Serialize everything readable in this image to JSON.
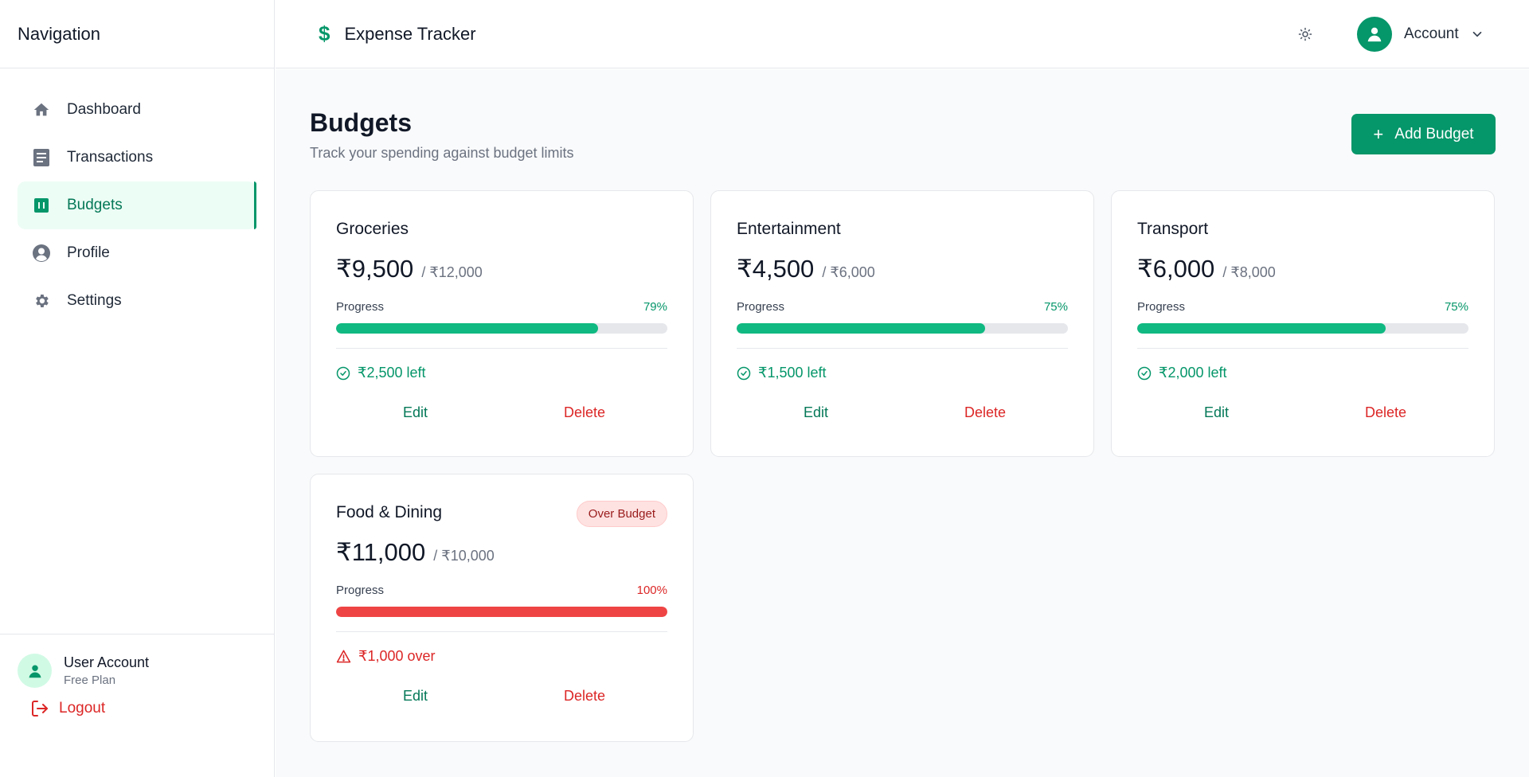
{
  "sidebar": {
    "title": "Navigation",
    "items": [
      {
        "label": "Dashboard",
        "icon": "home-icon"
      },
      {
        "label": "Transactions",
        "icon": "document-icon"
      },
      {
        "label": "Budgets",
        "icon": "chart-icon",
        "active": true
      },
      {
        "label": "Profile",
        "icon": "user-circle-icon"
      },
      {
        "label": "Settings",
        "icon": "gear-icon"
      }
    ],
    "user": {
      "name": "User Account",
      "plan": "Free Plan"
    },
    "logout_label": "Logout"
  },
  "header": {
    "app_title": "Expense Tracker",
    "account_label": "Account"
  },
  "page": {
    "title": "Budgets",
    "subtitle": "Track your spending against budget limits",
    "add_button_label": "Add Budget"
  },
  "budgets": [
    {
      "name": "Groceries",
      "spent": "₹9,500",
      "limit": "/ ₹12,000",
      "progress_label": "Progress",
      "percent_text": "79%",
      "progress": 0.79,
      "status": "₹2,500 left",
      "over": false,
      "edit_label": "Edit",
      "delete_label": "Delete"
    },
    {
      "name": "Entertainment",
      "spent": "₹4,500",
      "limit": "/ ₹6,000",
      "progress_label": "Progress",
      "percent_text": "75%",
      "progress": 0.75,
      "status": "₹1,500 left",
      "over": false,
      "edit_label": "Edit",
      "delete_label": "Delete"
    },
    {
      "name": "Transport",
      "spent": "₹6,000",
      "limit": "/ ₹8,000",
      "progress_label": "Progress",
      "percent_text": "75%",
      "progress": 0.75,
      "status": "₹2,000 left",
      "over": false,
      "edit_label": "Edit",
      "delete_label": "Delete"
    },
    {
      "name": "Food & Dining",
      "spent": "₹11,000",
      "limit": "/ ₹10,000",
      "progress_label": "Progress",
      "percent_text": "100%",
      "progress": 1.0,
      "status": "₹1,000 over",
      "over": true,
      "badge": "Over Budget",
      "edit_label": "Edit",
      "delete_label": "Delete"
    }
  ],
  "colors": {
    "accent": "#059669",
    "progress_ok": "#10b981",
    "progress_over": "#ef4444",
    "danger": "#dc2626"
  }
}
